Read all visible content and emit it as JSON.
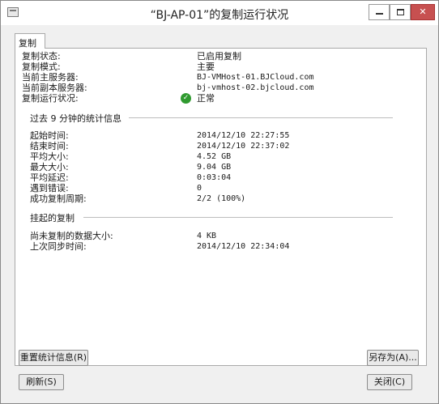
{
  "window": {
    "title": "“BJ-AP-01”的复制运行状况"
  },
  "tab": {
    "label": "复制"
  },
  "summary": [
    {
      "label": "复制状态:",
      "value": "已启用复制"
    },
    {
      "label": "复制模式:",
      "value": "主要"
    },
    {
      "label": "当前主服务器:",
      "value": "BJ-VMHost-01.BJCloud.com"
    },
    {
      "label": "当前副本服务器:",
      "value": "bj-vmhost-02.bjcloud.com"
    },
    {
      "label": "复制运行状况:",
      "value": "正常",
      "icon": "check-circle-icon",
      "icon_color": "#2f9a2f"
    }
  ],
  "stats": {
    "title": "过去 9 分钟的统计信息",
    "rows": [
      {
        "label": "起始时间:",
        "value": "2014/12/10 22:27:55"
      },
      {
        "label": "结束时间:",
        "value": "2014/12/10 22:37:02"
      },
      {
        "label": "平均大小:",
        "value": "4.52 GB"
      },
      {
        "label": "最大大小:",
        "value": "9.04 GB"
      },
      {
        "label": "平均延迟:",
        "value": "0:03:04"
      },
      {
        "label": "遇到错误:",
        "value": "0"
      },
      {
        "label": "成功复制周期:",
        "value": "2/2 (100%)"
      }
    ]
  },
  "pending": {
    "title": "挂起的复制",
    "rows": [
      {
        "label": "尚未复制的数据大小:",
        "value": "4 KB"
      },
      {
        "label": "上次同步时间:",
        "value": "2014/12/10 22:34:04"
      }
    ]
  },
  "buttons": {
    "reset_stats": "重置统计信息(R)",
    "save_as": "另存为(A)...",
    "refresh": "刷新(S)",
    "close": "关闭(C)"
  },
  "colors": {
    "close_button": "#c75050",
    "ok": "#2f9a2f"
  }
}
